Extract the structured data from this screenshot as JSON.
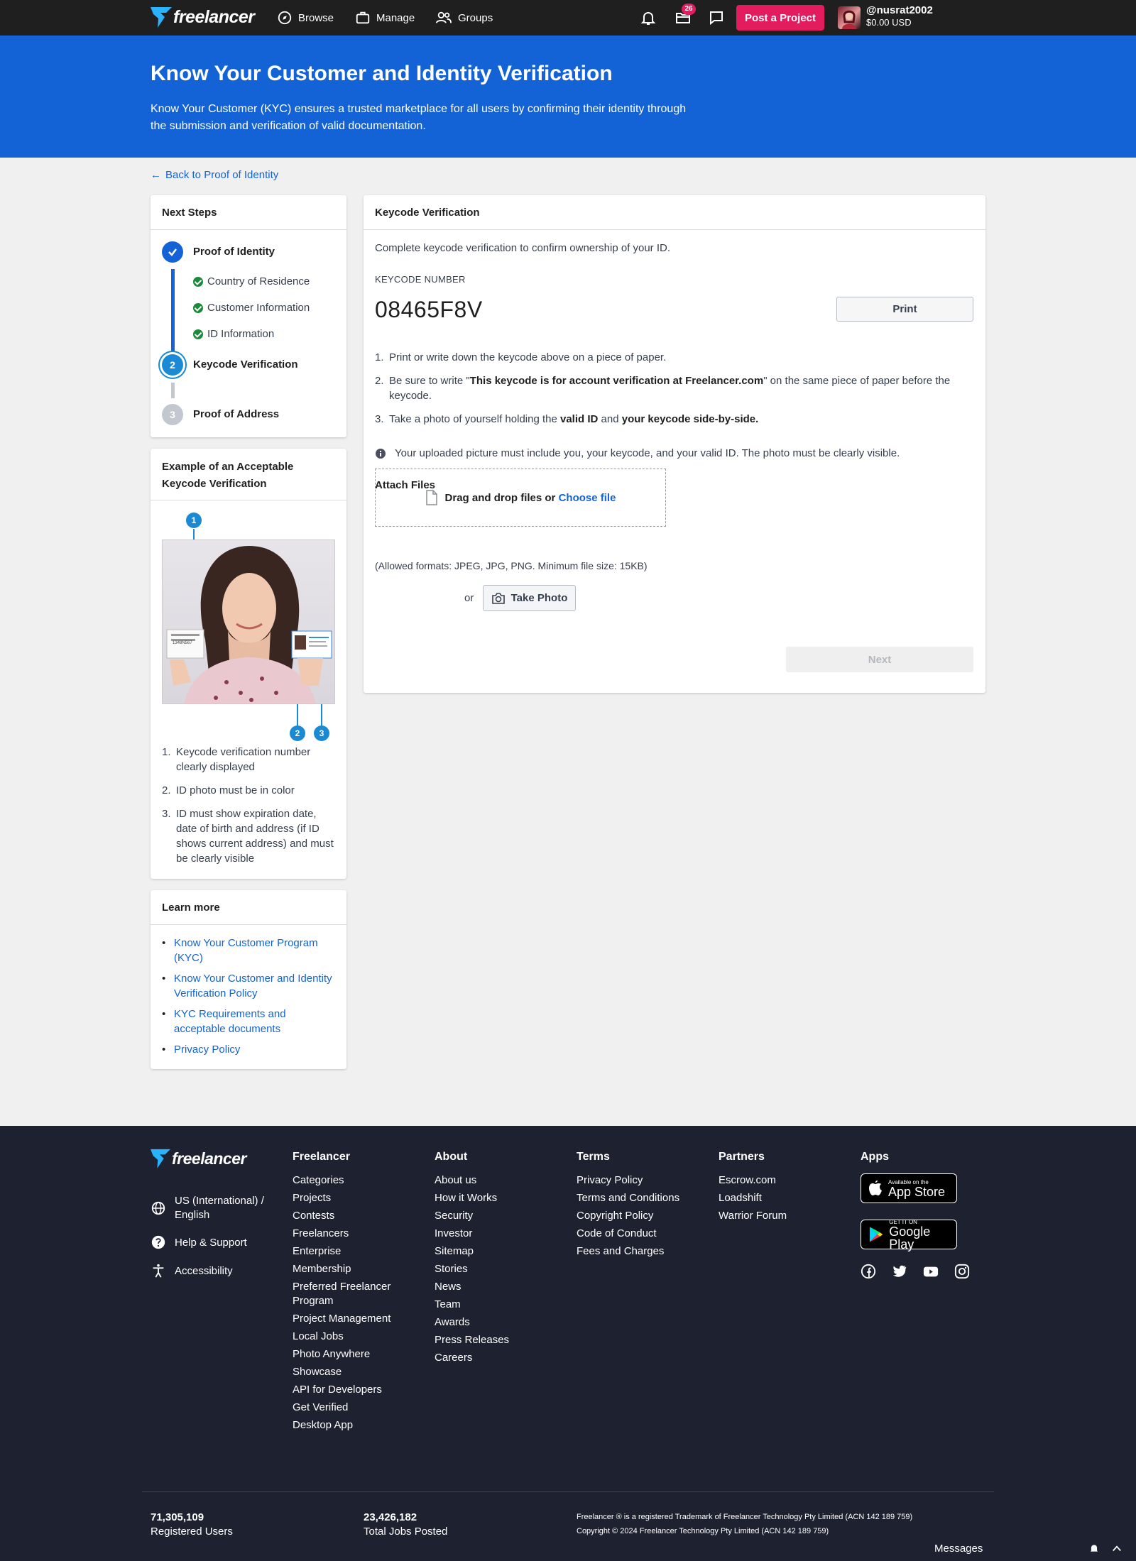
{
  "nav": {
    "logo": "freelancer",
    "browse": "Browse",
    "manage": "Manage",
    "groups": "Groups",
    "notif_badge": "26",
    "post_project": "Post a Project",
    "username": "@nusrat2002",
    "balance": "$0.00 USD"
  },
  "hero": {
    "title": "Know Your Customer and Identity Verification",
    "description": "Know Your Customer (KYC) ensures a trusted marketplace for all users by confirming their identity through the submission and verification of valid documentation."
  },
  "back_link": "Back to Proof of Identity",
  "steps": {
    "header": "Next Steps",
    "step1": "Proof of Identity",
    "sub1": "Country of Residence",
    "sub2": "Customer Information",
    "sub3": "ID Information",
    "step2_num": "2",
    "step2": "Keycode Verification",
    "step3_num": "3",
    "step3": "Proof of Address"
  },
  "example": {
    "header": "Example of an Acceptable Keycode Verification",
    "pin1": "1",
    "pin2": "2",
    "pin3": "3",
    "photo_keycode": "1348N567",
    "item1": "Keycode verification number clearly displayed",
    "item2": "ID photo must be in color",
    "item3": "ID must show expiration date, date of birth and address (if ID shows current address) and must be clearly visible"
  },
  "learn_more": {
    "header": "Learn more",
    "links": [
      "Know Your Customer Program (KYC)",
      "Know Your Customer and Identity Verification Policy",
      "KYC Requirements and acceptable documents",
      "Privacy Policy"
    ]
  },
  "keycode": {
    "header": "Keycode Verification",
    "intro": "Complete keycode verification to confirm ownership of your ID.",
    "number_label": "KEYCODE NUMBER",
    "number": "08465F8V",
    "print": "Print",
    "step1": "Print or write down the keycode above on a piece of paper.",
    "step2_pre": "Be sure to write \"",
    "step2_bold": "This keycode is for account verification at Freelancer.com",
    "step2_post": "\" on the same piece of paper before the keycode.",
    "step3_pre": "Take a photo of yourself holding the ",
    "step3_b1": "valid ID",
    "step3_mid": " and ",
    "step3_b2": "your keycode side-by-side.",
    "info": "Your uploaded picture must include you, your keycode, and your valid ID. The photo must be clearly visible.",
    "attach_label": "Attach Files",
    "drop_text": "Drag and drop files or ",
    "choose_file": "Choose file",
    "formats": "(Allowed formats: JPEG, JPG, PNG. Minimum file size: 15KB)",
    "or": "or",
    "take_photo": "Take Photo",
    "next": "Next"
  },
  "footer": {
    "logo": "freelancer",
    "locale": "US (International) / English",
    "help": "Help & Support",
    "accessibility": "Accessibility",
    "columns": [
      {
        "title": "Freelancer",
        "links": [
          "Categories",
          "Projects",
          "Contests",
          "Freelancers",
          "Enterprise",
          "Membership",
          "Preferred Freelancer Program",
          "Project Management",
          "Local Jobs",
          "Photo Anywhere",
          "Showcase",
          "API for Developers",
          "Get Verified",
          "Desktop App"
        ]
      },
      {
        "title": "About",
        "links": [
          "About us",
          "How it Works",
          "Security",
          "Investor",
          "Sitemap",
          "Stories",
          "News",
          "Team",
          "Awards",
          "Press Releases",
          "Careers"
        ]
      },
      {
        "title": "Terms",
        "links": [
          "Privacy Policy",
          "Terms and Conditions",
          "Copyright Policy",
          "Code of Conduct",
          "Fees and Charges"
        ]
      },
      {
        "title": "Partners",
        "links": [
          "Escrow.com",
          "Loadshift",
          "Warrior Forum"
        ]
      }
    ],
    "apps_title": "Apps",
    "appstore_small": "Available on the",
    "appstore_big": "App Store",
    "play_small": "GET IT ON",
    "play_big": "Google Play",
    "registered_users_n": "71,305,109",
    "registered_users_l": "Registered Users",
    "jobs_n": "23,426,182",
    "jobs_l": "Total Jobs Posted",
    "legal1": "Freelancer ® is a registered Trademark of Freelancer Technology Pty Limited (ACN 142 189 759)",
    "legal2": "Copyright © 2024 Freelancer Technology Pty Limited (ACN 142 189 759)",
    "messages": "Messages"
  },
  "colors": {
    "brand_blue": "#1363d6",
    "pink": "#e31c5f",
    "dark": "#1f1f1f",
    "footer": "#1e2230",
    "success": "#1b8a3a"
  }
}
